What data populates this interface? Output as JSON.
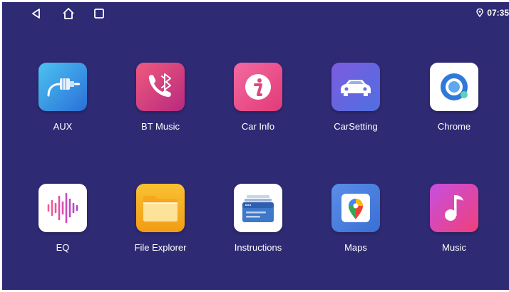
{
  "status_bar": {
    "time": "07:35",
    "nav_buttons": [
      "back-icon",
      "home-icon",
      "recents-icon"
    ],
    "location_icon": "location-pin-icon"
  },
  "apps": [
    {
      "label": "AUX",
      "icon": "aux-cable-icon",
      "color": "#36a3e8"
    },
    {
      "label": "BT Music",
      "icon": "bluetooth-phone-icon",
      "color": "#d9417d"
    },
    {
      "label": "Car Info",
      "icon": "info-icon",
      "color": "#ee4f8e"
    },
    {
      "label": "CarSetting",
      "icon": "car-icon",
      "color": "#6a63d9"
    },
    {
      "label": "Chrome",
      "icon": "chrome-icon",
      "color": "#ffffff"
    },
    {
      "label": "EQ",
      "icon": "equalizer-icon",
      "color": "#ffffff"
    },
    {
      "label": "File Explorer",
      "icon": "folder-icon",
      "color": "#f5b21c"
    },
    {
      "label": "Instructions",
      "icon": "instructions-icon",
      "color": "#ffffff"
    },
    {
      "label": "Maps",
      "icon": "maps-icon",
      "color": "#4a82e0"
    },
    {
      "label": "Music",
      "icon": "music-note-icon",
      "color": "#b647d2"
    }
  ]
}
